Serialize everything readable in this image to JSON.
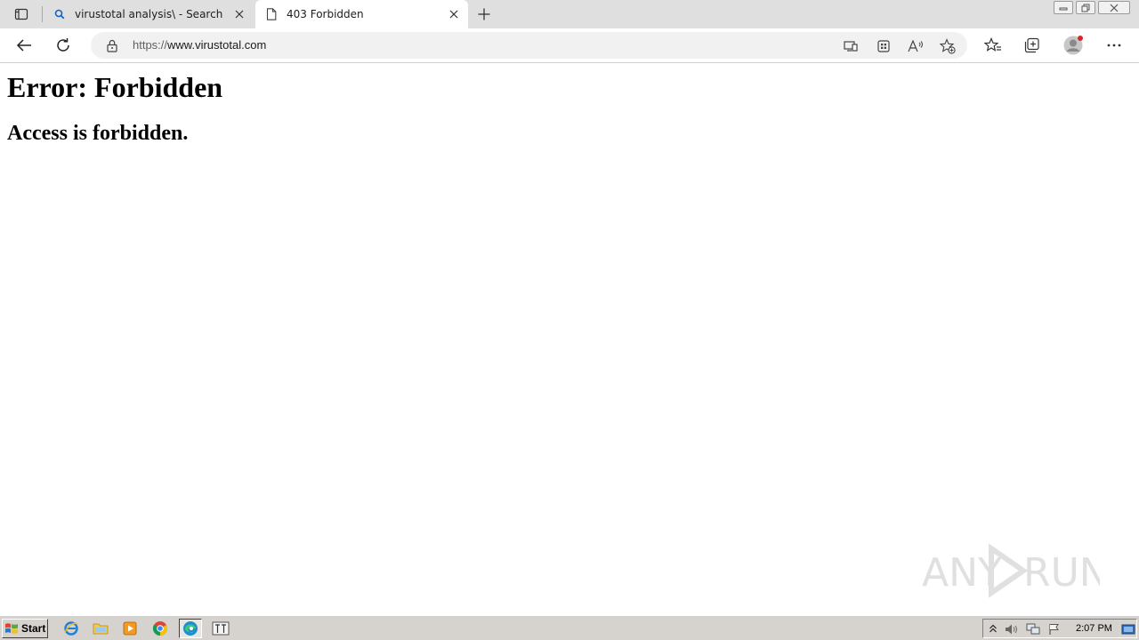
{
  "browser": {
    "tabs": [
      {
        "title": "virustotal analysis\\ - Search",
        "icon": "search-icon",
        "active": false
      },
      {
        "title": "403 Forbidden",
        "icon": "page-icon",
        "active": true
      }
    ],
    "address": {
      "protocol": "https://",
      "host": "www.virustotal.com"
    }
  },
  "page": {
    "heading": "Error: Forbidden",
    "message": "Access is forbidden."
  },
  "watermark": {
    "text_left": "ANY",
    "text_right": "RUN"
  },
  "taskbar": {
    "start_label": "Start",
    "clock": "2:07 PM"
  },
  "colors": {
    "tabbar_bg": "#dfdfdf",
    "address_bg": "#f1f1f1",
    "taskbar_bg": "#d6d3ce",
    "profile_badge": "#d9232e"
  }
}
